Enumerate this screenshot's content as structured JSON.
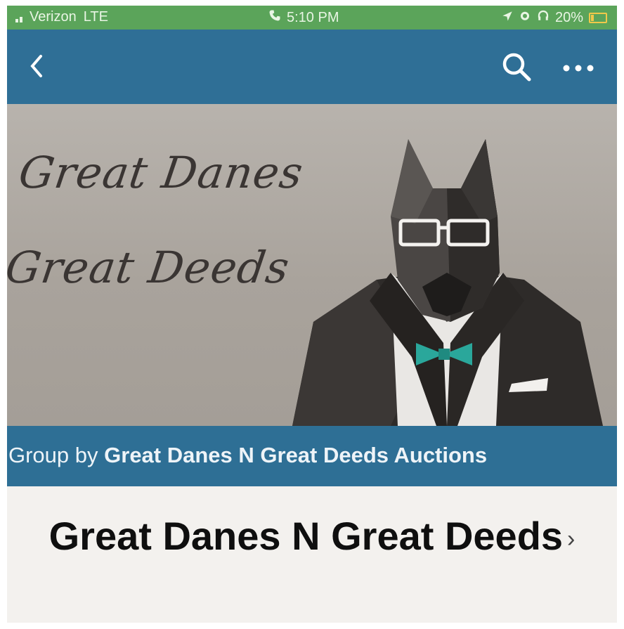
{
  "status_bar": {
    "carrier": "Verizon",
    "network": "LTE",
    "time": "5:10 PM",
    "battery": "20%"
  },
  "nav": {
    "back_icon": "chevron-left-icon",
    "search_icon": "search-icon",
    "more_icon": "more-icon"
  },
  "banner": {
    "line1": "Great Danes",
    "line2": "Great Deeds"
  },
  "group": {
    "prefix": "Group by",
    "name": "Great Danes N Great Deeds Auctions"
  },
  "title": {
    "text": "Great Danes N Great Deeds",
    "chevron": "›"
  },
  "colors": {
    "status_green": "#5ba45a",
    "nav_blue": "#2f6f96",
    "bow_tie": "#2aa79b"
  }
}
